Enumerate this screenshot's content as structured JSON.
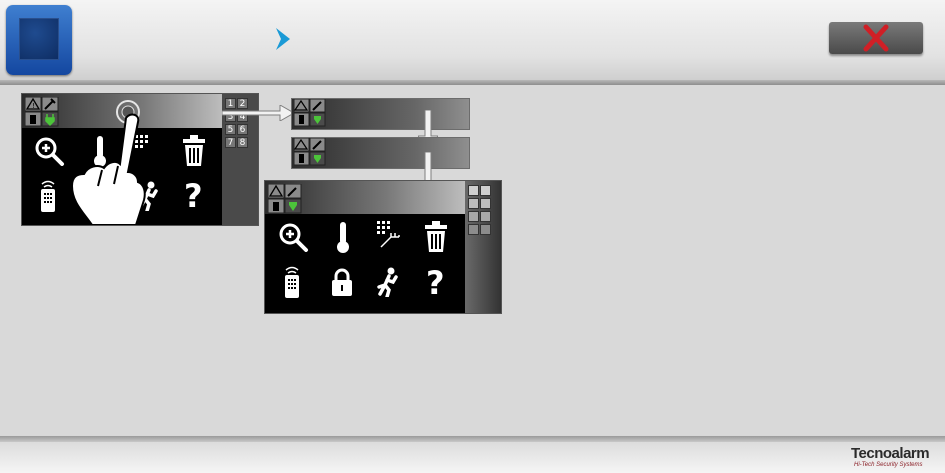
{
  "header": {
    "home_icon": "home-square-icon",
    "breadcrumb_icon": "chevron-right-icon",
    "close_icon": "close-x-icon"
  },
  "diagram": {
    "panel_a": {
      "keypad_labels": [
        "1",
        "2",
        "3",
        "4",
        "5",
        "6",
        "7",
        "8"
      ]
    },
    "panel_icons": [
      "zoom-in-icon",
      "thermometer-icon",
      "keypad-icon",
      "trash-icon",
      "remote-control-icon",
      "lock-icon",
      "running-man-icon",
      "help-icon"
    ],
    "help_symbol": "?"
  },
  "footer": {
    "brand": "Tecnoalarm",
    "tagline": "Hi-Tech Security Systems"
  },
  "colors": {
    "home_blue": "#1f5ab4",
    "close_red": "#d01f26",
    "accent_blue": "#1a9ad6",
    "plug_green": "#4cc43a"
  }
}
